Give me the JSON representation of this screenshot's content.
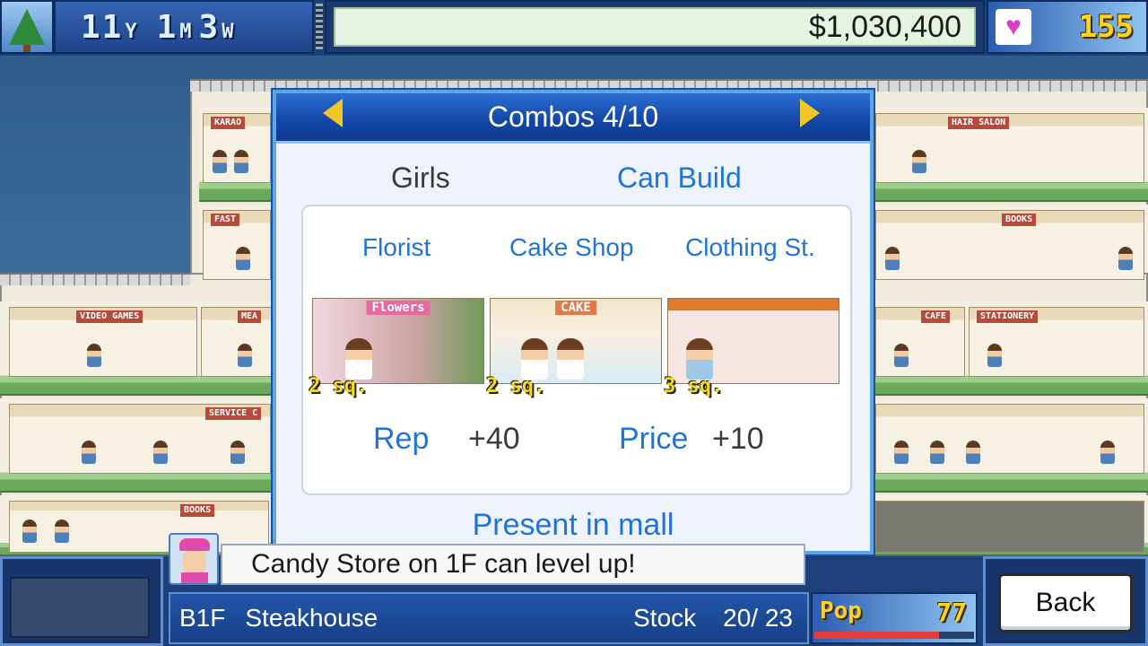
{
  "hud": {
    "years": "11",
    "year_unit": "Y",
    "months": "1",
    "month_unit": "M",
    "weeks": "3",
    "week_unit": "W",
    "money": "$1,030,400",
    "hearts": "155",
    "season_icon": "tree-icon",
    "heart_icon": "heart-icon"
  },
  "combo_panel": {
    "title": "Combos 4/10",
    "category": "Girls",
    "can_build": "Can Build",
    "shops": [
      {
        "name": "Florist",
        "size": "2 sq.",
        "sign": "Flowers"
      },
      {
        "name": "Cake Shop",
        "size": "2 sq.",
        "sign": "CAKE"
      },
      {
        "name": "Clothing St.",
        "size": "3 sq.",
        "sign": ""
      }
    ],
    "rep_label": "Rep",
    "rep_value": "+40",
    "price_label": "Price",
    "price_value": "+10",
    "present": "Present in mall"
  },
  "mall_signs": {
    "karaoke": "KARAO",
    "fast_food": "FAST",
    "video_games": "VIDEO GAMES",
    "meat": "MEA",
    "service": "SERVICE C",
    "books_left": "BOOKS",
    "hair_salon": "HAIR SALON",
    "books_right": "BOOKS",
    "cafe": "CAFE",
    "stationery": "STATIONERY"
  },
  "notification": "Candy Store on 1F can level up!",
  "status": {
    "floor": "B1F",
    "shop": "Steakhouse",
    "stock_label": "Stock",
    "stock": "20/  23"
  },
  "pop": {
    "label": "Pop",
    "value": "77",
    "fill": 0.78
  },
  "back_label": "Back",
  "colors": {
    "accent_blue": "#1f74d4",
    "gold": "#f3c627",
    "hud_blue": "#1d3f7a"
  }
}
